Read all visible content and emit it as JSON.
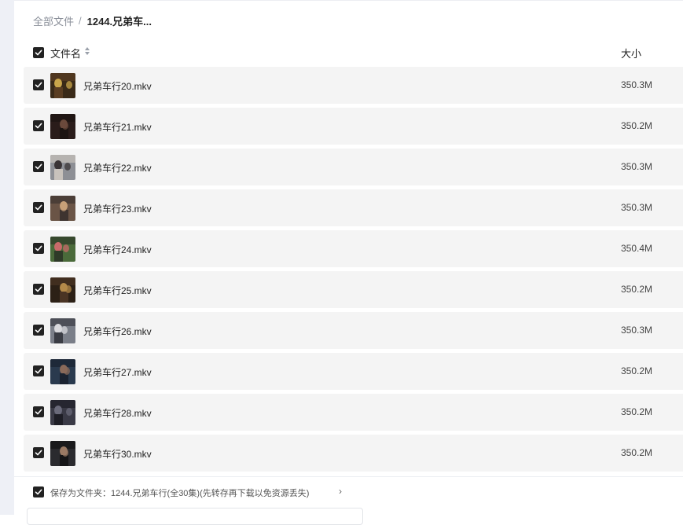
{
  "breadcrumb": {
    "root": "全部文件",
    "separator": "/",
    "current": "1244.兄弟车..."
  },
  "header": {
    "name_label": "文件名",
    "size_label": "大小"
  },
  "files": [
    {
      "name": "兄弟车行20.mkv",
      "size": "350.3M",
      "thumb": [
        "#3a2a18",
        "#c9a54a",
        "#5a3d22"
      ]
    },
    {
      "name": "兄弟车行21.mkv",
      "size": "350.2M",
      "thumb": [
        "#2a1c1a",
        "#6b4a3c",
        "#1c1412"
      ]
    },
    {
      "name": "兄弟车行22.mkv",
      "size": "350.3M",
      "thumb": [
        "#8d8f95",
        "#3a3436",
        "#c8c2bc"
      ]
    },
    {
      "name": "兄弟车行23.mkv",
      "size": "350.3M",
      "thumb": [
        "#6a5446",
        "#c8a078",
        "#3e3430"
      ]
    },
    {
      "name": "兄弟车行24.mkv",
      "size": "350.4M",
      "thumb": [
        "#4a6a3a",
        "#c86a6a",
        "#2e3a28"
      ]
    },
    {
      "name": "兄弟车行25.mkv",
      "size": "350.2M",
      "thumb": [
        "#2c2016",
        "#b48a4a",
        "#4a3424"
      ]
    },
    {
      "name": "兄弟车行26.mkv",
      "size": "350.3M",
      "thumb": [
        "#7a7e88",
        "#d8d8dc",
        "#3a3c44"
      ]
    },
    {
      "name": "兄弟车行27.mkv",
      "size": "350.2M",
      "thumb": [
        "#2a3a4e",
        "#8a6a5a",
        "#1a2230"
      ]
    },
    {
      "name": "兄弟车行28.mkv",
      "size": "350.2M",
      "thumb": [
        "#3a3a46",
        "#6a6a7a",
        "#1e1e26"
      ]
    },
    {
      "name": "兄弟车行30.mkv",
      "size": "350.2M",
      "thumb": [
        "#2a2a2e",
        "#9a7a64",
        "#141416"
      ]
    }
  ],
  "footer": {
    "save_label": "保存为文件夹：1244.兄弟车行(全30集)(先转存再下载以免资源丢失)",
    "arrow": "›"
  },
  "colors": {
    "checkbox": "#222222",
    "row_bg": "#f4f4f4",
    "breadcrumb_root": "#8a8f99"
  }
}
